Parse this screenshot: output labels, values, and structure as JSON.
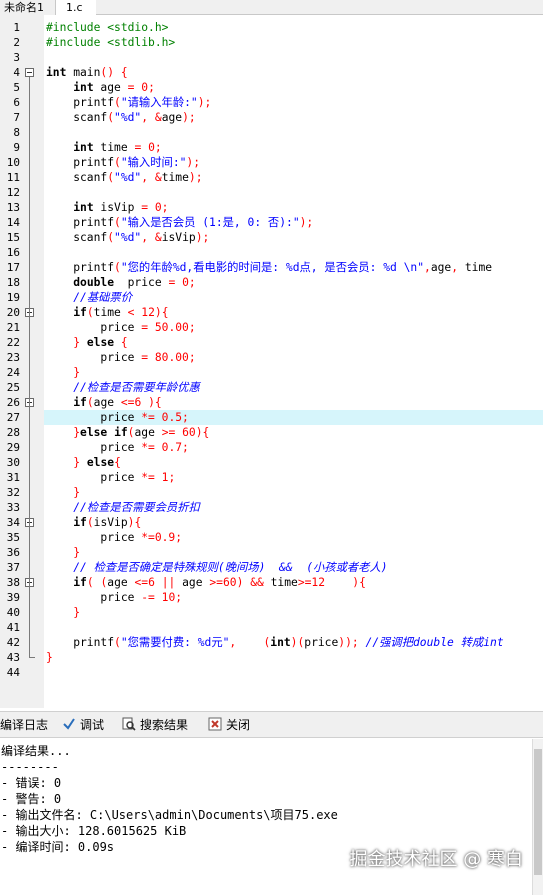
{
  "tabs": [
    {
      "label": "未命名1"
    },
    {
      "label": "1.c"
    }
  ],
  "editor": {
    "lines": [
      [
        [
          "pp",
          "#include <stdio.h>"
        ]
      ],
      [
        [
          "pp",
          "#include <stdlib.h>"
        ]
      ],
      [],
      [
        [
          "kw",
          "int"
        ],
        [
          "id",
          " main"
        ],
        [
          "op",
          "()"
        ],
        [
          "id",
          " "
        ],
        [
          "br",
          "{"
        ]
      ],
      [
        [
          "id",
          "    "
        ],
        [
          "kw",
          "int"
        ],
        [
          "id",
          " age "
        ],
        [
          "op",
          "="
        ],
        [
          "id",
          " "
        ],
        [
          "num",
          "0"
        ],
        [
          "op",
          ";"
        ]
      ],
      [
        [
          "id",
          "    printf"
        ],
        [
          "op",
          "("
        ],
        [
          "str",
          "\"请输入年龄:\""
        ],
        [
          "op",
          ");"
        ]
      ],
      [
        [
          "id",
          "    scanf"
        ],
        [
          "op",
          "("
        ],
        [
          "str",
          "\"%d\""
        ],
        [
          "op",
          ","
        ],
        [
          "id",
          " "
        ],
        [
          "op",
          "&"
        ],
        [
          "id",
          "age"
        ],
        [
          "op",
          ");"
        ]
      ],
      [],
      [
        [
          "id",
          "    "
        ],
        [
          "kw",
          "int"
        ],
        [
          "id",
          " time "
        ],
        [
          "op",
          "="
        ],
        [
          "id",
          " "
        ],
        [
          "num",
          "0"
        ],
        [
          "op",
          ";"
        ]
      ],
      [
        [
          "id",
          "    printf"
        ],
        [
          "op",
          "("
        ],
        [
          "str",
          "\"输入时间:\""
        ],
        [
          "op",
          ");"
        ]
      ],
      [
        [
          "id",
          "    scanf"
        ],
        [
          "op",
          "("
        ],
        [
          "str",
          "\"%d\""
        ],
        [
          "op",
          ","
        ],
        [
          "id",
          " "
        ],
        [
          "op",
          "&"
        ],
        [
          "id",
          "time"
        ],
        [
          "op",
          ");"
        ]
      ],
      [],
      [
        [
          "id",
          "    "
        ],
        [
          "kw",
          "int"
        ],
        [
          "id",
          " isVip "
        ],
        [
          "op",
          "="
        ],
        [
          "id",
          " "
        ],
        [
          "num",
          "0"
        ],
        [
          "op",
          ";"
        ]
      ],
      [
        [
          "id",
          "    printf"
        ],
        [
          "op",
          "("
        ],
        [
          "str",
          "\"输入是否会员 (1:是, 0: 否):\""
        ],
        [
          "op",
          ");"
        ]
      ],
      [
        [
          "id",
          "    scanf"
        ],
        [
          "op",
          "("
        ],
        [
          "str",
          "\"%d\""
        ],
        [
          "op",
          ","
        ],
        [
          "id",
          " "
        ],
        [
          "op",
          "&"
        ],
        [
          "id",
          "isVip"
        ],
        [
          "op",
          ");"
        ]
      ],
      [],
      [
        [
          "id",
          "    printf"
        ],
        [
          "op",
          "("
        ],
        [
          "str",
          "\"您的年龄%d,看电影的时间是: %d点, 是否会员: %d \\n\""
        ],
        [
          "op",
          ","
        ],
        [
          "id",
          "age"
        ],
        [
          "op",
          ","
        ],
        [
          "id",
          " time"
        ]
      ],
      [
        [
          "id",
          "    "
        ],
        [
          "kw",
          "double"
        ],
        [
          "id",
          "  price "
        ],
        [
          "op",
          "="
        ],
        [
          "id",
          " "
        ],
        [
          "num",
          "0"
        ],
        [
          "op",
          ";"
        ]
      ],
      [
        [
          "id",
          "    "
        ],
        [
          "cm",
          "//基础票价"
        ]
      ],
      [
        [
          "id",
          "    "
        ],
        [
          "kw",
          "if"
        ],
        [
          "op",
          "("
        ],
        [
          "id",
          "time "
        ],
        [
          "op",
          "<"
        ],
        [
          "id",
          " "
        ],
        [
          "num",
          "12"
        ],
        [
          "op",
          ")"
        ],
        [
          "br",
          "{"
        ]
      ],
      [
        [
          "id",
          "        price "
        ],
        [
          "op",
          "="
        ],
        [
          "id",
          " "
        ],
        [
          "num",
          "50.00"
        ],
        [
          "op",
          ";"
        ]
      ],
      [
        [
          "id",
          "    "
        ],
        [
          "br",
          "}"
        ],
        [
          "id",
          " "
        ],
        [
          "kw",
          "else"
        ],
        [
          "id",
          " "
        ],
        [
          "br",
          "{"
        ]
      ],
      [
        [
          "id",
          "        price "
        ],
        [
          "op",
          "="
        ],
        [
          "id",
          " "
        ],
        [
          "num",
          "80.00"
        ],
        [
          "op",
          ";"
        ]
      ],
      [
        [
          "id",
          "    "
        ],
        [
          "br",
          "}"
        ]
      ],
      [
        [
          "id",
          "    "
        ],
        [
          "cm",
          "//检查是否需要年龄优惠"
        ]
      ],
      [
        [
          "id",
          "    "
        ],
        [
          "kw",
          "if"
        ],
        [
          "op",
          "("
        ],
        [
          "id",
          "age "
        ],
        [
          "op",
          "<="
        ],
        [
          "num",
          "6"
        ],
        [
          "id",
          " "
        ],
        [
          "op",
          ")"
        ],
        [
          "br",
          "{"
        ]
      ],
      [
        [
          "id",
          "        price "
        ],
        [
          "op",
          "*="
        ],
        [
          "id",
          " "
        ],
        [
          "num",
          "0.5"
        ],
        [
          "op",
          ";"
        ]
      ],
      [
        [
          "id",
          "    "
        ],
        [
          "br",
          "}"
        ],
        [
          "kw",
          "else"
        ],
        [
          "id",
          " "
        ],
        [
          "kw",
          "if"
        ],
        [
          "op",
          "("
        ],
        [
          "id",
          "age "
        ],
        [
          "op",
          ">="
        ],
        [
          "id",
          " "
        ],
        [
          "num",
          "60"
        ],
        [
          "op",
          ")"
        ],
        [
          "br",
          "{"
        ]
      ],
      [
        [
          "id",
          "        price "
        ],
        [
          "op",
          "*="
        ],
        [
          "id",
          " "
        ],
        [
          "num",
          "0.7"
        ],
        [
          "op",
          ";"
        ]
      ],
      [
        [
          "id",
          "    "
        ],
        [
          "br",
          "}"
        ],
        [
          "id",
          " "
        ],
        [
          "kw",
          "else"
        ],
        [
          "br",
          "{"
        ]
      ],
      [
        [
          "id",
          "        price "
        ],
        [
          "op",
          "*="
        ],
        [
          "id",
          " "
        ],
        [
          "num",
          "1"
        ],
        [
          "op",
          ";"
        ]
      ],
      [
        [
          "id",
          "    "
        ],
        [
          "br",
          "}"
        ]
      ],
      [
        [
          "id",
          "    "
        ],
        [
          "cm",
          "//检查是否需要会员折扣"
        ]
      ],
      [
        [
          "id",
          "    "
        ],
        [
          "kw",
          "if"
        ],
        [
          "op",
          "("
        ],
        [
          "id",
          "isVip"
        ],
        [
          "op",
          ")"
        ],
        [
          "br",
          "{"
        ]
      ],
      [
        [
          "id",
          "        price "
        ],
        [
          "op",
          "*="
        ],
        [
          "num",
          "0.9"
        ],
        [
          "op",
          ";"
        ]
      ],
      [
        [
          "id",
          "    "
        ],
        [
          "br",
          "}"
        ]
      ],
      [
        [
          "id",
          "    "
        ],
        [
          "cm",
          "// 检查是否确定是特殊规则(晚间场)  &&  (小孩或者老人)"
        ]
      ],
      [
        [
          "id",
          "    "
        ],
        [
          "kw",
          "if"
        ],
        [
          "op",
          "("
        ],
        [
          "id",
          " "
        ],
        [
          "op",
          "("
        ],
        [
          "id",
          "age "
        ],
        [
          "op",
          "<="
        ],
        [
          "num",
          "6"
        ],
        [
          "id",
          " "
        ],
        [
          "op",
          "||"
        ],
        [
          "id",
          " age "
        ],
        [
          "op",
          ">="
        ],
        [
          "num",
          "60"
        ],
        [
          "op",
          ")"
        ],
        [
          "id",
          " "
        ],
        [
          "op",
          "&&"
        ],
        [
          "id",
          " time"
        ],
        [
          "op",
          ">="
        ],
        [
          "num",
          "12"
        ],
        [
          "id",
          "    "
        ],
        [
          "op",
          ")"
        ],
        [
          "br",
          "{"
        ]
      ],
      [
        [
          "id",
          "        price "
        ],
        [
          "op",
          "-="
        ],
        [
          "id",
          " "
        ],
        [
          "num",
          "10"
        ],
        [
          "op",
          ";"
        ]
      ],
      [
        [
          "id",
          "    "
        ],
        [
          "br",
          "}"
        ]
      ],
      [],
      [
        [
          "id",
          "    printf"
        ],
        [
          "op",
          "("
        ],
        [
          "str",
          "\"您需要付费: %d元\""
        ],
        [
          "op",
          ","
        ],
        [
          "id",
          "    "
        ],
        [
          "op",
          "("
        ],
        [
          "kw",
          "int"
        ],
        [
          "op",
          ")("
        ],
        [
          "id",
          "price"
        ],
        [
          "op",
          "));"
        ],
        [
          "id",
          " "
        ],
        [
          "cm",
          "//强调把double 转成int"
        ]
      ],
      [
        [
          "br",
          "}"
        ]
      ],
      []
    ]
  },
  "tool_tabs": [
    {
      "label": "编译日志",
      "icon": "compile-log-icon"
    },
    {
      "label": "调试",
      "icon": "debug-check-icon"
    },
    {
      "label": "搜索结果",
      "icon": "search-results-icon"
    },
    {
      "label": "关闭",
      "icon": "close-icon"
    }
  ],
  "log": {
    "lines": [
      "编译结果...",
      "--------",
      "- 错误: 0",
      "- 警告: 0",
      "- 输出文件名: C:\\Users\\admin\\Documents\\项目75.exe",
      "- 输出大小: 128.6015625 KiB",
      "- 编译时间: 0.09s"
    ]
  },
  "watermark": "掘金技术社区 @ 寒白",
  "colors": {
    "keyword": "#000000",
    "preprocessor": "#008000",
    "string": "#0000ff",
    "comment": "#0000ff",
    "number_operator": "#ff0000",
    "current_line": "#d6f5fb"
  }
}
